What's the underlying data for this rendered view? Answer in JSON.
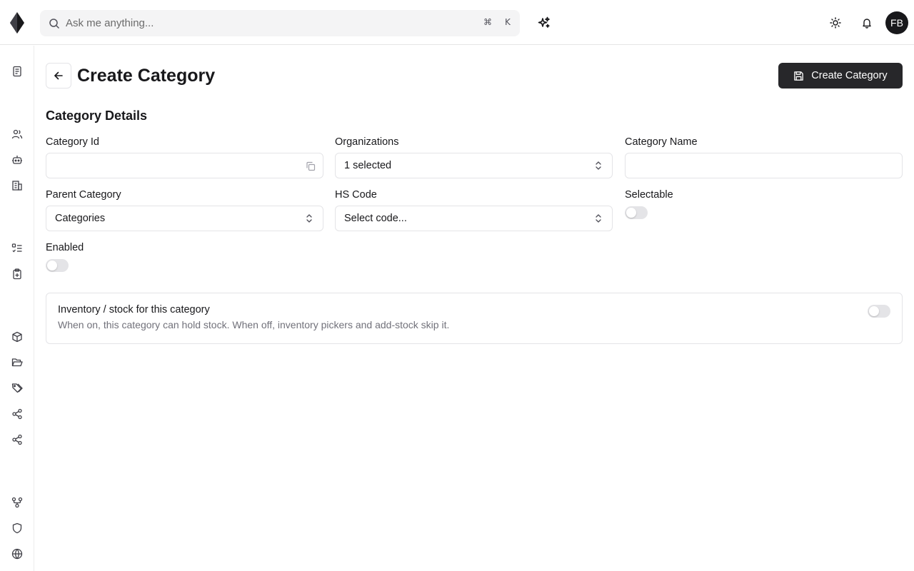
{
  "search": {
    "placeholder": "Ask me anything...",
    "shortcut_cmd": "⌘",
    "shortcut_key": "K"
  },
  "user": {
    "initials": "FB"
  },
  "sidebar": {
    "items": [
      {
        "name": "documents-icon"
      },
      {
        "name": "users-icon"
      },
      {
        "name": "bot-icon"
      },
      {
        "name": "building-icon"
      },
      {
        "name": "checklist-icon"
      },
      {
        "name": "clipboard-icon"
      },
      {
        "name": "package-icon"
      },
      {
        "name": "folder-open-icon"
      },
      {
        "name": "tags-icon"
      },
      {
        "name": "share-icon"
      },
      {
        "name": "share-alt-icon"
      },
      {
        "name": "workflow-icon"
      },
      {
        "name": "shield-icon"
      },
      {
        "name": "globe-icon"
      }
    ]
  },
  "header": {
    "title": "Create Category",
    "create_label": "Create Category"
  },
  "form": {
    "section_title": "Category Details",
    "category_id": {
      "label": "Category Id",
      "value": ""
    },
    "organizations": {
      "label": "Organizations",
      "value": "1 selected"
    },
    "category_name": {
      "label": "Category Name",
      "value": ""
    },
    "parent_category": {
      "label": "Parent Category",
      "value": "Categories"
    },
    "hs_code": {
      "label": "HS Code",
      "value": "Select code..."
    },
    "selectable": {
      "label": "Selectable",
      "checked": false
    },
    "enabled": {
      "label": "Enabled",
      "checked": false
    }
  },
  "inventory": {
    "title": "Inventory / stock for this category",
    "description": "When on, this category can hold stock. When off, inventory pickers and add-stock skip it.",
    "checked": false
  },
  "colors": {
    "primary": "#27272a",
    "border": "#e4e4e7",
    "muted": "#71717a",
    "switch_off": "#e4e4e7"
  }
}
